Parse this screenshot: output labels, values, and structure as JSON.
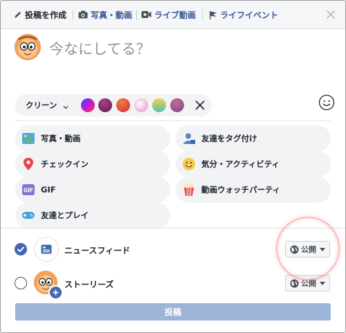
{
  "header": {
    "tabs": [
      {
        "label": "投稿を作成",
        "icon": "pencil-icon"
      },
      {
        "label": "写真・動画",
        "icon": "camera-icon"
      },
      {
        "label": "ライブ動画",
        "icon": "live-video-icon"
      },
      {
        "label": "ライフイベント",
        "icon": "flag-icon"
      }
    ],
    "close_icon": "close-icon"
  },
  "composer": {
    "placeholder": "今なにしてる？"
  },
  "background_bar": {
    "label": "クリーン",
    "swatches": [
      "#6a3df0",
      "#8a3a6a",
      "#e2574a",
      "#f1c4d8",
      "#7ac66f",
      "#a86090"
    ]
  },
  "actions": [
    {
      "label": "写真・動画",
      "icon": "photo-icon"
    },
    {
      "label": "友達をタグ付け",
      "icon": "tag-friends-icon"
    },
    {
      "label": "チェックイン",
      "icon": "location-pin-icon"
    },
    {
      "label": "気分・アクティビティ",
      "icon": "smiley-icon"
    },
    {
      "label": "GIF",
      "icon": "gif-icon"
    },
    {
      "label": "動画ウォッチパーティ",
      "icon": "popcorn-icon"
    },
    {
      "label": "友達とプレイ",
      "icon": "gamepad-icon"
    }
  ],
  "destinations": [
    {
      "label": "ニュースフィード",
      "checked": true,
      "privacy": "公開"
    },
    {
      "label": "ストーリーズ",
      "checked": false,
      "privacy": "公開"
    }
  ],
  "post_button": "投稿",
  "colors": {
    "link": "#365899",
    "accent": "#4267b2",
    "post_disabled": "#9cb4d8"
  }
}
